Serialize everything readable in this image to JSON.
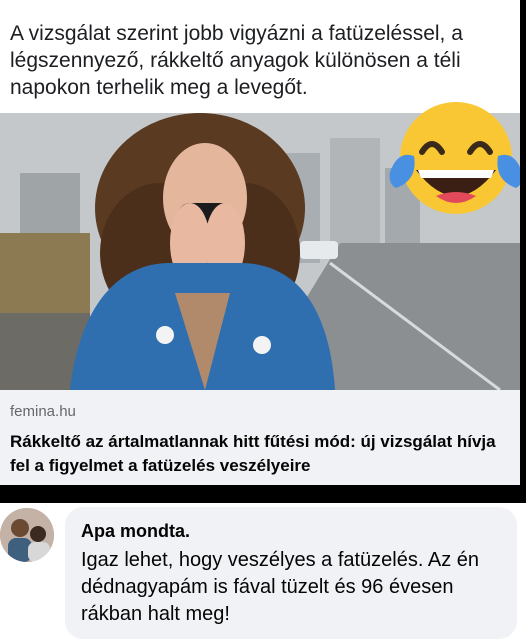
{
  "post": {
    "text": "A vizsgálat szerint jobb vigyázni a fatüzeléssel, a légszennyező, rákkeltő anyagok különösen a téli napokon terhelik meg a levegőt."
  },
  "link": {
    "domain": "femina.hu",
    "title": "Rákkeltő az ártalmatlannak hitt fűtési mód: új vizsgálat hívja fel a figyelmet a fatüzelés veszélyeire"
  },
  "reaction": {
    "icon": "laughing-tears-emoji-icon"
  },
  "comment": {
    "author": "Apa mondta.",
    "text": "Igaz lehet, hogy veszélyes a fatüzelés. Az én dédnagyapám is fával tüzelt és 96 évesen rákban halt meg!"
  },
  "colors": {
    "card_bg": "#ffffff",
    "meta_bg": "#f0f2f5",
    "bubble_bg": "#f0f2f5",
    "domain_text": "#65676b",
    "coat_blue": "#2f6fb0",
    "emoji_yellow": "#f9c734",
    "tear_blue": "#4a90e2"
  }
}
